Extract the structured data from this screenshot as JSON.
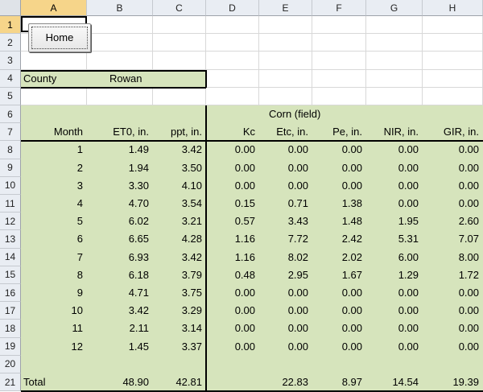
{
  "columns": [
    "A",
    "B",
    "C",
    "D",
    "E",
    "F",
    "G",
    "H"
  ],
  "rows": [
    "1",
    "2",
    "3",
    "4",
    "5",
    "6",
    "7",
    "8",
    "9",
    "10",
    "11",
    "12",
    "13",
    "14",
    "15",
    "16",
    "17",
    "18",
    "19",
    "20",
    "21"
  ],
  "home_button": "Home",
  "county": {
    "label": "County",
    "value": "Rowan"
  },
  "crop_title": "Corn (field)",
  "headers": [
    "Month",
    "ET0, in.",
    "ppt, in.",
    "Kc",
    "Etc, in.",
    "Pe, in.",
    "NIR, in.",
    "GIR, in."
  ],
  "table": [
    [
      "1",
      "1.49",
      "3.42",
      "0.00",
      "0.00",
      "0.00",
      "0.00",
      "0.00"
    ],
    [
      "2",
      "1.94",
      "3.50",
      "0.00",
      "0.00",
      "0.00",
      "0.00",
      "0.00"
    ],
    [
      "3",
      "3.30",
      "4.10",
      "0.00",
      "0.00",
      "0.00",
      "0.00",
      "0.00"
    ],
    [
      "4",
      "4.70",
      "3.54",
      "0.15",
      "0.71",
      "1.38",
      "0.00",
      "0.00"
    ],
    [
      "5",
      "6.02",
      "3.21",
      "0.57",
      "3.43",
      "1.48",
      "1.95",
      "2.60"
    ],
    [
      "6",
      "6.65",
      "4.28",
      "1.16",
      "7.72",
      "2.42",
      "5.31",
      "7.07"
    ],
    [
      "7",
      "6.93",
      "3.42",
      "1.16",
      "8.02",
      "2.02",
      "6.00",
      "8.00"
    ],
    [
      "8",
      "6.18",
      "3.79",
      "0.48",
      "2.95",
      "1.67",
      "1.29",
      "1.72"
    ],
    [
      "9",
      "4.71",
      "3.75",
      "0.00",
      "0.00",
      "0.00",
      "0.00",
      "0.00"
    ],
    [
      "10",
      "3.42",
      "3.29",
      "0.00",
      "0.00",
      "0.00",
      "0.00",
      "0.00"
    ],
    [
      "11",
      "2.11",
      "3.14",
      "0.00",
      "0.00",
      "0.00",
      "0.00",
      "0.00"
    ],
    [
      "12",
      "1.45",
      "3.37",
      "0.00",
      "0.00",
      "0.00",
      "0.00",
      "0.00"
    ]
  ],
  "total": {
    "label": "Total",
    "values": [
      "48.90",
      "42.81",
      "",
      "22.83",
      "8.97",
      "14.54",
      "19.39"
    ]
  },
  "colors": {
    "fill": "#d6e4bc",
    "header": "#e9edf3",
    "selected_header": "#f6d58a"
  }
}
